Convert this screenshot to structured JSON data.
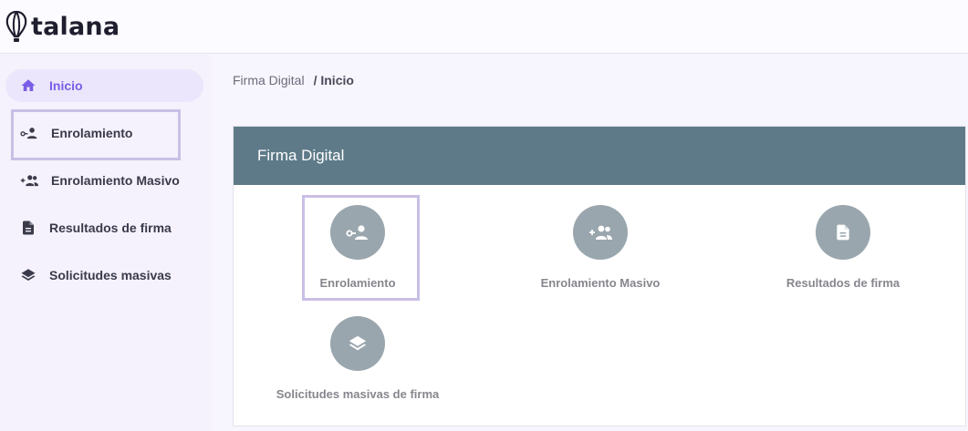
{
  "brand": {
    "name": "talana"
  },
  "sidebar": {
    "items": [
      {
        "label": "Inicio",
        "icon": "home-icon",
        "active": true
      },
      {
        "label": "Enrolamiento",
        "icon": "key-person-icon"
      },
      {
        "label": "Enrolamiento Masivo",
        "icon": "add-group-icon"
      },
      {
        "label": "Resultados de firma",
        "icon": "document-icon"
      },
      {
        "label": "Solicitudes masivas",
        "icon": "layers-icon"
      }
    ]
  },
  "breadcrumb": {
    "parent": "Firma Digital",
    "current": "/ Inicio"
  },
  "card": {
    "title": "Firma Digital",
    "tiles": [
      {
        "label": "Enrolamiento",
        "icon": "key-person-icon"
      },
      {
        "label": "Enrolamiento Masivo",
        "icon": "add-group-icon"
      },
      {
        "label": "Resultados de firma",
        "icon": "document-icon"
      },
      {
        "label": "Solicitudes masivas de firma",
        "icon": "layers-icon"
      }
    ]
  },
  "colors": {
    "accent": "#7a5ce6",
    "header": "#5e7a89",
    "tile_circle": "#9aa6ad",
    "highlight_border": "#c9bfe6"
  }
}
